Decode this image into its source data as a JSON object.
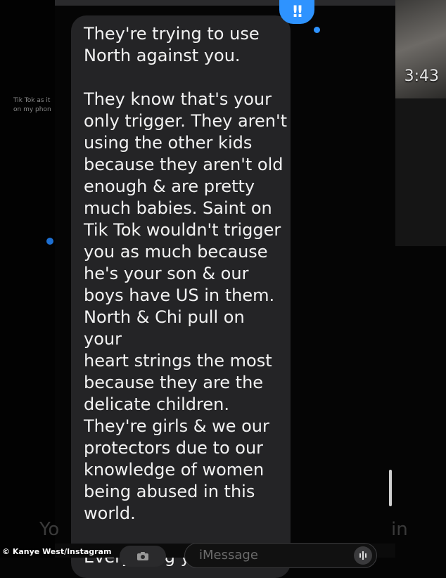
{
  "background": {
    "left_caption": "Tik Tok as it on my phon",
    "video_time": "3:43",
    "ghost_left_text": "Yo",
    "ghost_right_text": "in"
  },
  "message": {
    "text": "They're trying to use\nNorth against you.\n\nThey know that's your\nonly trigger. They aren't\nusing the other kids\nbecause they aren't old\nenough & are pretty\nmuch babies. Saint on\nTik Tok wouldn't trigger\nyou as much because\nhe's your son & our\nboys have US in them.\nNorth & Chi pull on your\nheart strings the most\nbecause they are the\ndelicate children.\nThey're girls & we our\nprotectors due to our\nknowledge of women\nbeing abused in this\nworld.\n\nEverything you say NO",
    "reaction": "‼",
    "reaction_icon": "exclamation-tapback-icon",
    "bubble_color": "#242426",
    "reaction_color": "#2e93ff"
  },
  "composer": {
    "placeholder": "iMessage",
    "camera_icon": "camera-icon",
    "audio_icon": "audio-waveform-icon"
  },
  "credit": "© Kanye West/Instagram"
}
